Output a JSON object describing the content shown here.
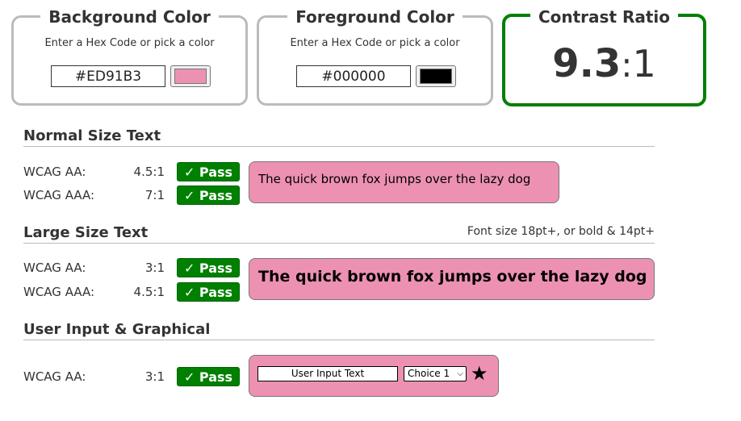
{
  "background": {
    "title": "Background Color",
    "subtitle": "Enter a Hex Code or pick a color",
    "hex": "#ED91B3",
    "color": "#ED91B3"
  },
  "foreground": {
    "title": "Foreground Color",
    "subtitle": "Enter a Hex Code or pick a color",
    "hex": "#000000",
    "color": "#000000"
  },
  "contrast": {
    "title": "Contrast Ratio",
    "ratio": "9.3",
    "separator": ":",
    "denominator": "1",
    "accent_color": "#008000"
  },
  "normal_text": {
    "title": "Normal Size Text",
    "rows": [
      {
        "label": "WCAG AA:",
        "ratio": "4.5:1",
        "result": "✓ Pass"
      },
      {
        "label": "WCAG AAA:",
        "ratio": "7:1",
        "result": "✓ Pass"
      }
    ],
    "sample": "The quick brown fox jumps over the lazy dog"
  },
  "large_text": {
    "title": "Large Size Text",
    "note": "Font size 18pt+, or bold & 14pt+",
    "rows": [
      {
        "label": "WCAG AA:",
        "ratio": "3:1",
        "result": "✓ Pass"
      },
      {
        "label": "WCAG AAA:",
        "ratio": "4.5:1",
        "result": "✓ Pass"
      }
    ],
    "sample": "The quick brown fox jumps over the lazy dog"
  },
  "graphical": {
    "title": "User Input & Graphical",
    "rows": [
      {
        "label": "WCAG AA:",
        "ratio": "3:1",
        "result": "✓ Pass"
      }
    ],
    "input_text": "User Input Text",
    "select_value": "Choice 1",
    "star_icon": "star-icon"
  },
  "colors": {
    "pass": "#008000",
    "panel_border": "#bbbbbb"
  }
}
